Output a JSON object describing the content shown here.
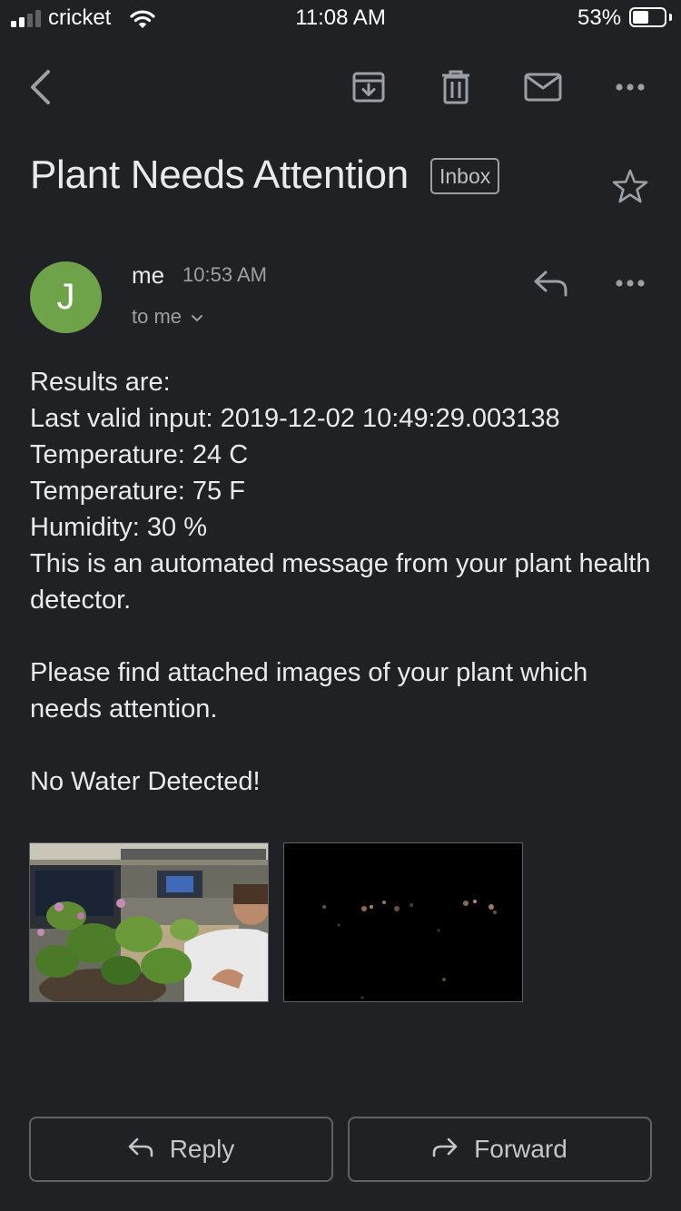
{
  "status_bar": {
    "carrier": "cricket",
    "time": "11:08 AM",
    "battery_percent": "53%",
    "battery_level": 0.53,
    "signal_bars": 2
  },
  "toolbar": {
    "icons": [
      "back-icon",
      "archive-icon",
      "delete-icon",
      "mark-unread-icon",
      "more-icon"
    ]
  },
  "email": {
    "subject": "Plant Needs Attention",
    "label": "Inbox",
    "sender": {
      "avatar_letter": "J",
      "avatar_color": "#6fa34a",
      "name": "me",
      "time": "10:53 AM",
      "recipient": "to me"
    },
    "body": {
      "line1": "Results are:",
      "line2": "Last valid input: 2019-12-02 10:49:29.003138",
      "line3": "Temperature: 24 C",
      "line4": "Temperature: 75 F",
      "line5": "Humidity: 30 %",
      "line6": "This is an automated message from your plant health detector.",
      "line7": "Please find attached images of your plant which needs attention.",
      "line8": "No Water Detected!"
    },
    "attachments": [
      {
        "kind": "photo",
        "description_icon": "plant-photo"
      },
      {
        "kind": "photo",
        "description_icon": "mask-photo"
      }
    ]
  },
  "actions": {
    "reply_label": "Reply",
    "forward_label": "Forward"
  },
  "colors": {
    "background": "#202124",
    "text": "#e8eaed",
    "secondary_text": "#9aa0a6"
  }
}
